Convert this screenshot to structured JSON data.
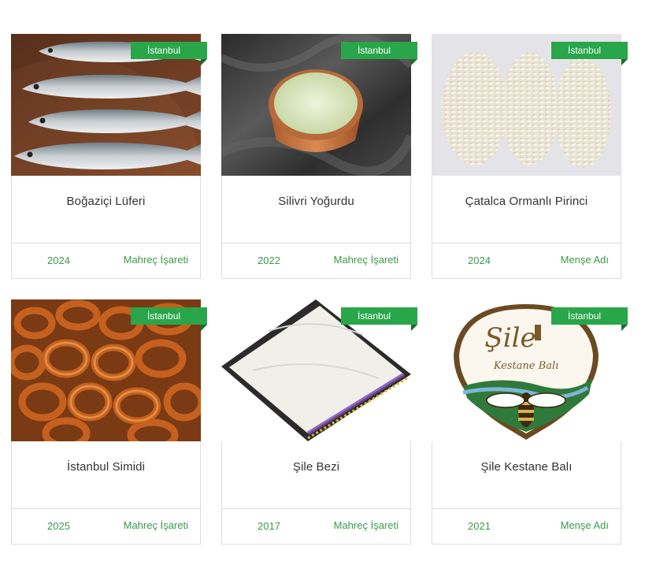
{
  "colors": {
    "accent": "#2aa64a",
    "accent_dark": "#1b6d30",
    "footer_text": "#3a9a4a",
    "title_text": "#333333",
    "border": "#dcdcdc"
  },
  "cards": [
    {
      "region": "İstanbul",
      "title": "Boğaziçi Lüferi",
      "year": "2024",
      "type": "Mahreç İşareti",
      "image": "bluefish-photo"
    },
    {
      "region": "İstanbul",
      "title": "Silivri Yoğurdu",
      "year": "2022",
      "type": "Mahreç İşareti",
      "image": "yogurt-photo"
    },
    {
      "region": "İstanbul",
      "title": "Çatalca Ormanlı Pirinci",
      "year": "2024",
      "type": "Menşe Adı",
      "image": "rice-photo"
    },
    {
      "region": "İstanbul",
      "title": "İstanbul Simidi",
      "year": "2025",
      "type": "Mahreç İşareti",
      "image": "simit-photo"
    },
    {
      "region": "İstanbul",
      "title": "Şile Bezi",
      "year": "2017",
      "type": "Mahreç İşareti",
      "image": "sile-cloth-photo"
    },
    {
      "region": "İstanbul",
      "title": "Şile Kestane Balı",
      "year": "2021",
      "type": "Menşe Adı",
      "image": "chestnut-honey-logo",
      "logo_text": "Şile",
      "logo_subtext": "Kestane Balı"
    }
  ]
}
